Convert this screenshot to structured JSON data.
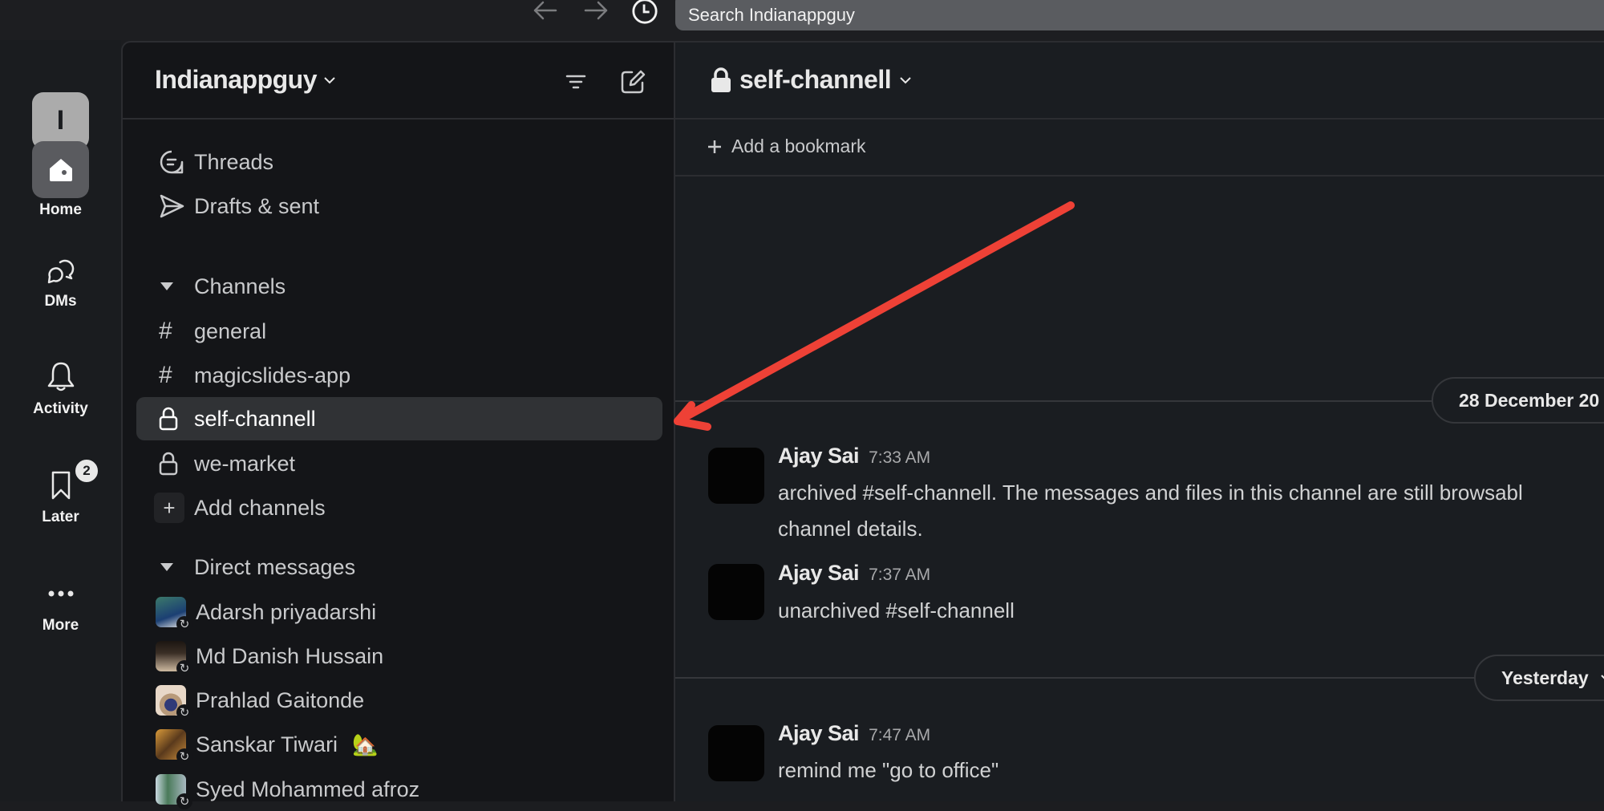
{
  "topbar": {
    "back_icon": "arrow-left-icon",
    "forward_icon": "arrow-right-icon",
    "history_icon": "clock-icon",
    "search_placeholder": "Search Indianappguy"
  },
  "rail": {
    "workspace_initial": "I",
    "items": [
      {
        "label": "Home",
        "icon": "home-icon",
        "active": true
      },
      {
        "label": "DMs",
        "icon": "dms-icon",
        "active": false
      },
      {
        "label": "Activity",
        "icon": "bell-icon",
        "active": false
      },
      {
        "label": "Later",
        "icon": "bookmark-icon",
        "active": false,
        "badge": "2"
      },
      {
        "label": "More",
        "icon": "more-icon",
        "active": false
      }
    ]
  },
  "sidebar": {
    "workspace_name": "Indianappguy",
    "filter_icon": "filter-icon",
    "compose_icon": "compose-icon",
    "nav": [
      {
        "label": "Threads",
        "icon": "threads-icon"
      },
      {
        "label": "Drafts & sent",
        "icon": "send-icon"
      }
    ],
    "channels_section": "Channels",
    "channels": [
      {
        "label": "general",
        "type": "public"
      },
      {
        "label": "magicslides-app",
        "type": "public"
      },
      {
        "label": "self-channell",
        "type": "private",
        "selected": true
      },
      {
        "label": "we-market",
        "type": "private"
      }
    ],
    "add_channels": "Add channels",
    "dm_section": "Direct messages",
    "dms": [
      {
        "name": "Adarsh priyadarshi",
        "color": "#2f6b5e"
      },
      {
        "name": "Md Danish Hussain",
        "color": "#6b5a4a"
      },
      {
        "name": "Prahlad Gaitonde",
        "color": "#c9b9a3"
      },
      {
        "name": "Sanskar Tiwari",
        "color": "#9a6a2a",
        "status_emoji": "🏡"
      },
      {
        "name": "Syed Mohammed afroz",
        "color": "#6b8c78"
      }
    ]
  },
  "channel": {
    "title": "self-channell",
    "add_bookmark": "Add a bookmark",
    "day_dividers": [
      "28 December 20",
      "Yesterday"
    ],
    "messages": [
      {
        "author": "Ajay Sai",
        "time": "7:33 AM",
        "lines": [
          "archived #self-channell. The messages and files in this channel are still browsabl",
          "channel details."
        ]
      },
      {
        "author": "Ajay Sai",
        "time": "7:37 AM",
        "lines": [
          "unarchived #self-channell"
        ]
      },
      {
        "author": "Ajay Sai",
        "time": "7:47 AM",
        "lines": [
          "remind me \"go to office\""
        ]
      }
    ]
  },
  "annotation": {
    "type": "arrow",
    "color": "#ee4136",
    "points_to": "self-channell"
  }
}
